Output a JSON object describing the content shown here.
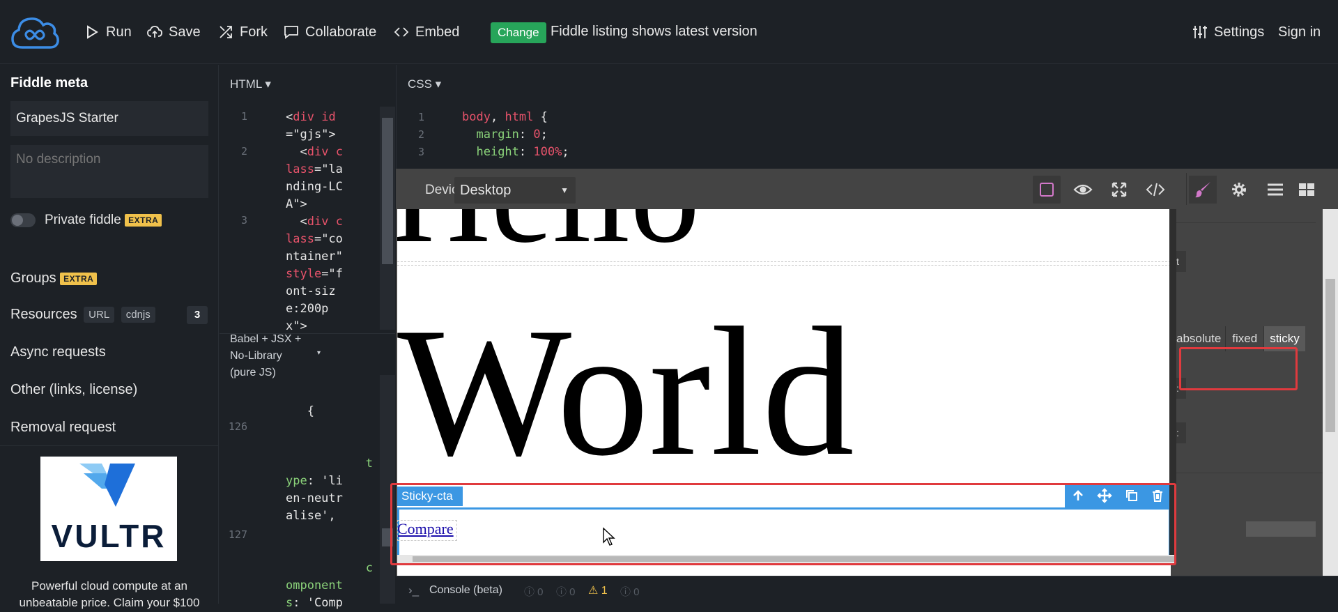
{
  "topbar": {
    "run": "Run",
    "save": "Save",
    "fork": "Fork",
    "collaborate": "Collaborate",
    "embed": "Embed",
    "change_badge": "Change",
    "change_message": "Fiddle listing shows latest version",
    "settings": "Settings",
    "sign_in": "Sign in"
  },
  "sidebar": {
    "meta_title": "Fiddle meta",
    "title_value": "GrapesJS Starter",
    "description_placeholder": "No description",
    "private_label": "Private fiddle",
    "extra_badge": "EXTRA",
    "groups": "Groups",
    "resources": "Resources",
    "resources_url": "URL",
    "resources_cdnjs": "cdnjs",
    "resources_count": "3",
    "async": "Async requests",
    "other": "Other (links, license)",
    "removal": "Removal request",
    "ad_brand": "VULTR",
    "ad_text_1": "Powerful cloud compute at an",
    "ad_text_2": "unbeatable price. Claim your $100"
  },
  "html_pane": {
    "title": "HTML ▾",
    "line_numbers": [
      "1",
      "2",
      "3"
    ],
    "js_title_1": "Babel + JSX +",
    "js_title_2": "No-Library",
    "js_title_3": "(pure JS)",
    "js_line_numbers": [
      "126",
      "127"
    ]
  },
  "css_pane": {
    "title": "CSS ▾",
    "line_numbers": [
      "1",
      "2",
      "3"
    ]
  },
  "gjs": {
    "device_label": "Device",
    "device_value": "Desktop",
    "canvas_word": "World",
    "selected_component": "Sticky-cta",
    "link_text": "Compare",
    "position_options": [
      "absolute",
      "fixed",
      "sticky"
    ]
  },
  "console": {
    "label": "Console (beta)",
    "counts": [
      "0",
      "0",
      "1",
      "0"
    ]
  },
  "colors": {
    "bg": "#1d2126",
    "accent_green": "#27a55a",
    "extra_yellow": "#f0c14b",
    "gjs_blue": "#3b97e3",
    "highlight_red": "#e03a3e"
  }
}
